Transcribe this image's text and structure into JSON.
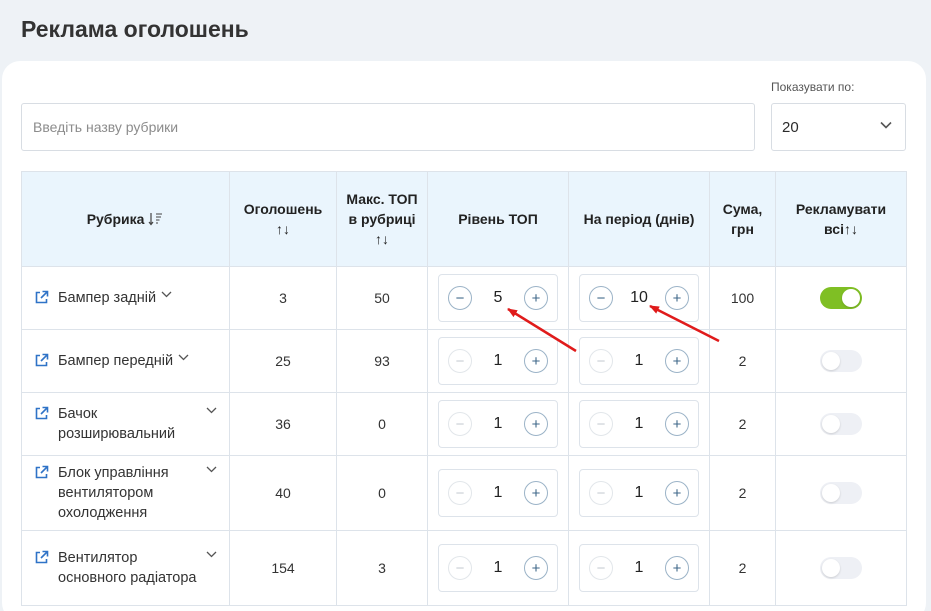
{
  "page": {
    "title": "Реклама оголошень"
  },
  "search": {
    "placeholder": "Введіть назву рубрики",
    "value": ""
  },
  "pagination": {
    "label": "Показувати по:",
    "value": "20"
  },
  "table": {
    "headers": {
      "rubric": "Рубрика",
      "ads": "Оголошень",
      "max_top": "Макс. ТОП в рубриці",
      "top_level": "Рівень ТОП",
      "period": "На період (днів)",
      "sum": "Сума, грн",
      "promote_all": "Рекламувати всі"
    },
    "sort_icons": {
      "rubric": "sort-desc-icon",
      "ads": "sort-arrows-icon",
      "max_top": "sort-arrows-icon",
      "promote_all": "sort-arrows-icon"
    },
    "rows": [
      {
        "name": "Бампер задній",
        "ads": "3",
        "max_top": "50",
        "top_level": "5",
        "period": "10",
        "sum": "100",
        "enabled": true
      },
      {
        "name": "Бампер передній",
        "ads": "25",
        "max_top": "93",
        "top_level": "1",
        "period": "1",
        "sum": "2",
        "enabled": false
      },
      {
        "name": "Бачок розширювальний",
        "ads": "36",
        "max_top": "0",
        "top_level": "1",
        "period": "1",
        "sum": "2",
        "enabled": false
      },
      {
        "name": "Блок управління вентилятором охолодження",
        "ads": "40",
        "max_top": "0",
        "top_level": "1",
        "period": "1",
        "sum": "2",
        "enabled": false
      },
      {
        "name": "Вентилятор основного радіатора",
        "ads": "154",
        "max_top": "3",
        "top_level": "1",
        "period": "1",
        "sum": "2",
        "enabled": false
      }
    ]
  },
  "colors": {
    "header_bg": "#eaf5fd",
    "toggle_on": "#7fbf24",
    "link_icon": "#2f73c7",
    "annotation_arrow": "#e01b1b"
  }
}
